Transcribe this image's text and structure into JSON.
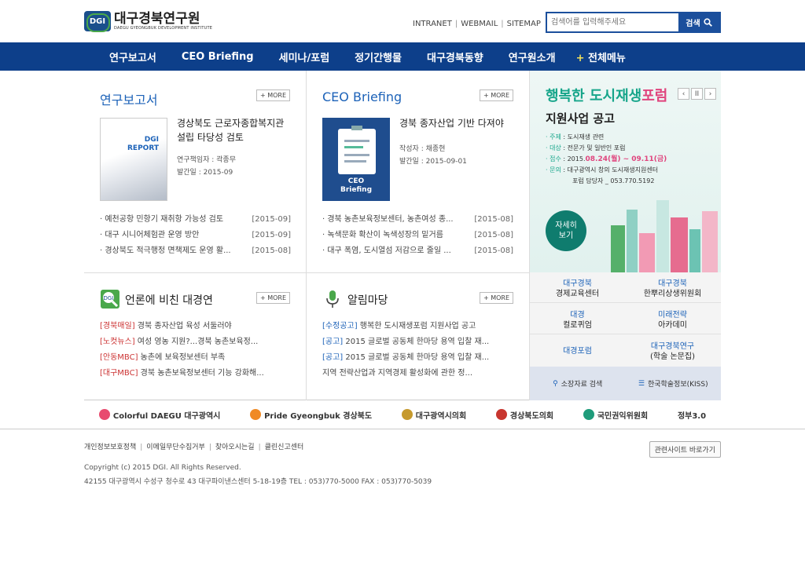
{
  "header": {
    "logo_abbr": "DGI",
    "logo_ko": "대구경북연구원",
    "logo_en": "DAEGU GYEONGBUK DEVELOPMENT INSTITUTE",
    "util": [
      "INTRANET",
      "WEBMAIL",
      "SITEMAP"
    ],
    "search_placeholder": "검색어를 입력해주세요",
    "search_button": "검색"
  },
  "nav": {
    "items": [
      "연구보고서",
      "CEO Briefing",
      "세미나/포럼",
      "정기간행물",
      "대구경북동향",
      "연구원소개"
    ],
    "all_plus": "+",
    "all_label": "전체메뉴"
  },
  "reports": {
    "title": "연구보고서",
    "more": "MORE",
    "thumb_text": "DGI REPORT",
    "featured_title": "경상북도 근로자종합복지관 설립 타당성 검토",
    "author": "연구책임자 : 곽종무",
    "date": "발간일 : 2015-09",
    "list": [
      {
        "title": "· 예천공항 민항기 재취항 가능성 검토",
        "date": "[2015-09]"
      },
      {
        "title": "· 대구 시니어체험관 운영 방안",
        "date": "[2015-09]"
      },
      {
        "title": "· 경상북도 적극행정 면책제도 운영 활...",
        "date": "[2015-08]"
      }
    ]
  },
  "ceo": {
    "title": "CEO Briefing",
    "more": "MORE",
    "thumb_text": "CEO Briefing",
    "featured_title": "경북 종자산업 기반 다져야",
    "author": "작성자 : 채종현",
    "date": "발간일 : 2015-09-01",
    "list": [
      {
        "title": "· 경북 농촌보육정보센터, 농촌여성 종...",
        "date": "[2015-08]"
      },
      {
        "title": "· 녹색문화 확산이 녹색성장의 밑거름",
        "date": "[2015-08]"
      },
      {
        "title": "· 대구 폭염, 도시열섬 저감으로 줄일 ...",
        "date": "[2015-08]"
      }
    ]
  },
  "press": {
    "title": "언론에 비친 대경연",
    "more": "MORE",
    "list": [
      {
        "tag": "[경북매일]",
        "text": " 경북 종자산업 육성 서둘러야"
      },
      {
        "tag": "[노컷뉴스]",
        "text": " 여성 영농 지원?...경북 농촌보육정..."
      },
      {
        "tag": "[안동MBC]",
        "text": " 농촌에 보육정보센터 부족"
      },
      {
        "tag": "[대구MBC]",
        "text": " 경북 농촌보육정보센터 기능 강화해..."
      }
    ]
  },
  "notice": {
    "title": "알림마당",
    "more": "MORE",
    "list": [
      {
        "tag": "[수정공고]",
        "text": " 행복한 도시재생포럼 지원사업 공고"
      },
      {
        "tag": "[공고]",
        "text": " 2015 글로벌 공동체 한마당 용역 입찰 재..."
      },
      {
        "tag": "[공고]",
        "text": " 2015 글로벌 공동체 한마당 용역 입찰 재..."
      },
      {
        "tag": "",
        "text": "지역 전략산업과 지역경제 활성화에 관한 정..."
      }
    ]
  },
  "banner": {
    "title_green": "행복한 도시재생",
    "title_pink": "포럼",
    "subtitle": "지원사업 공고",
    "controls": [
      "‹",
      "II",
      "›"
    ],
    "info": [
      {
        "k": "· 주제",
        "v": " : 도시재생 관련"
      },
      {
        "k": "· 대상",
        "v": " : 전문가 및 일반인 포럼"
      },
      {
        "k": "· 접수",
        "v": " : 2015.",
        "hl": "08.24(월) ~ 09.11(금)"
      },
      {
        "k": "· 문의",
        "v": " : 대구광역시 창의 도시재생지원센터"
      },
      {
        "k": "",
        "v": "          포럼 담당자 _ 053.770.5192"
      }
    ],
    "button": "자세히 보기"
  },
  "links": [
    {
      "a": "대구경북",
      "b": "경제교육센터"
    },
    {
      "a": "대구경북",
      "b": "한뿌리상생위원회"
    },
    {
      "a": "대경",
      "b": "컬로퀴엄"
    },
    {
      "a": "미래전략",
      "b": "아카데미"
    },
    {
      "a": "대경포럼",
      "b": ""
    },
    {
      "a": "대구경북연구",
      "b": "(학술 논문집)"
    }
  ],
  "links_bottom": [
    "소장자료 검색",
    "한국학술정보(KISS)"
  ],
  "partners": [
    "Colorful DAEGU 대구광역시",
    "Pride Gyeongbuk 경상북도",
    "대구광역시의회",
    "경상북도의회",
    "국민권익위원회",
    "정부3.0"
  ],
  "footer": {
    "nav": [
      "개인정보보호정책",
      "이메일무단수집거부",
      "찾아오시는길",
      "클린신고센터"
    ],
    "related": "관련사이트 바로가기",
    "copyright": "Copyright (c) 2015 DGI. All Rights Reserved.",
    "address": "42155 대구광역시 수성구 청수로 43 대구파이낸스센터 5-18-19층 TEL : 053)770-5000 FAX : 053)770-5039"
  },
  "colors": {
    "nav_bg": "#0d3f8a",
    "accent_blue": "#1c62b8",
    "banner_green": "#16a58a",
    "banner_pink": "#e0447d"
  }
}
